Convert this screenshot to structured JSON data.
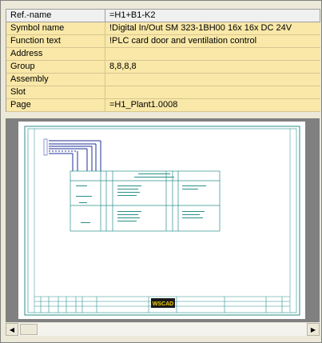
{
  "properties": {
    "header": {
      "name": "Ref.-name",
      "value": "=H1+B1-K2"
    },
    "rows": [
      {
        "name": "Symbol name",
        "value": "!Digital In/Out SM 323-1BH00 16x 16x DC 24V"
      },
      {
        "name": "Function text",
        "value": "!PLC card door and ventilation control"
      },
      {
        "name": "Address",
        "value": ""
      },
      {
        "name": "Group",
        "value": "8,8,8,8"
      },
      {
        "name": "Assembly",
        "value": ""
      },
      {
        "name": "Slot",
        "value": ""
      },
      {
        "name": "Page",
        "value": "=H1_Plant1.0008"
      }
    ]
  },
  "preview": {
    "logo_text": "WSCAD",
    "colors": {
      "drawing": "#2a8f8a",
      "wire": "#1f2f9a",
      "logo_bg": "#1a1a1a",
      "logo_fg": "#f5d000"
    }
  },
  "scrollbar": {
    "left_icon": "scroll-left-arrow-icon",
    "right_icon": "scroll-right-arrow-icon"
  }
}
